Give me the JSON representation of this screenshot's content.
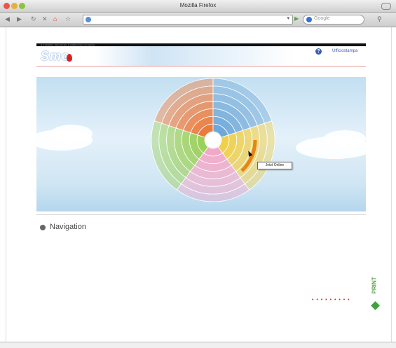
{
  "browser": {
    "window_title": "Mozilla Firefox",
    "search_placeholder": "Google",
    "url_dropdown_glyph": "▾"
  },
  "header": {
    "top_bar_text": "S.A. Modifica - Slice del sito, in collaborazione con partner",
    "logo_text": "Smo",
    "sky_text": "",
    "help_glyph": "?",
    "link_text": "Ufficiostampa"
  },
  "wheel": {
    "segments": [
      {
        "name": "orange",
        "color": "#ec7a3c"
      },
      {
        "name": "blue",
        "color": "#6fa8d8"
      },
      {
        "name": "yellow",
        "color": "#f0cf4a"
      },
      {
        "name": "pink",
        "color": "#f2a8c8"
      },
      {
        "name": "green",
        "color": "#9bd05a"
      }
    ],
    "tooltip": "Jetzt Online"
  },
  "navigation": {
    "title": "Navigation"
  },
  "footer": {
    "dots": "• • • • • • • • •"
  },
  "brand": {
    "text": "PRINT"
  }
}
